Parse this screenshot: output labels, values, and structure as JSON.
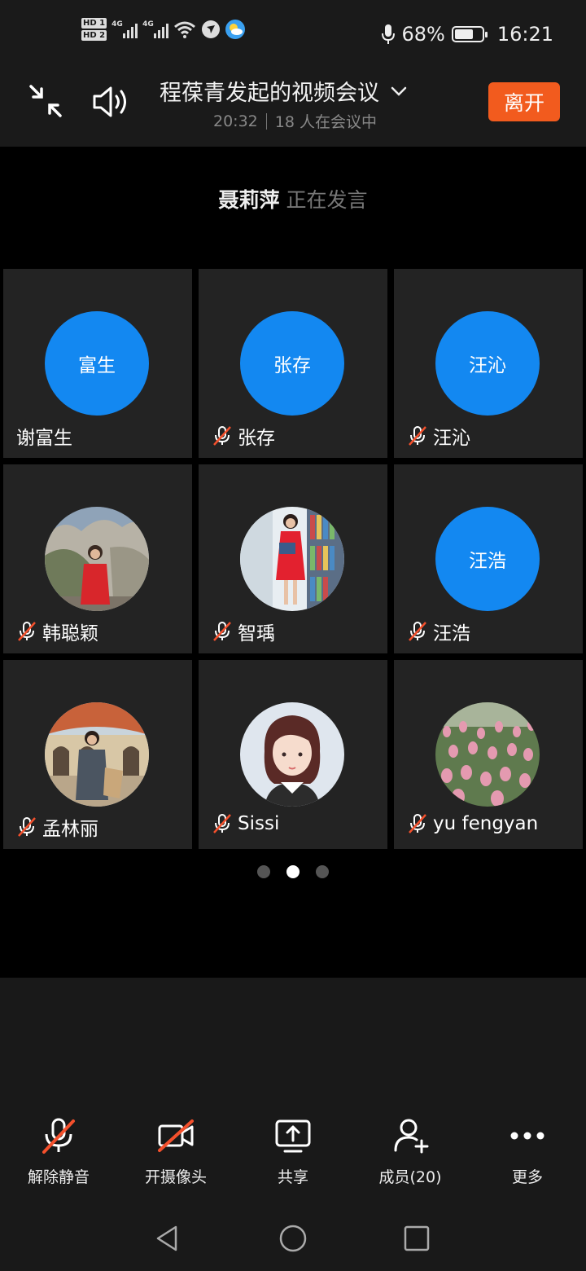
{
  "status_bar": {
    "hd1": "HD 1",
    "hd2": "HD 2",
    "net1": "4G",
    "net2": "4G",
    "battery_percent": "68%",
    "battery_level": 0.68,
    "time": "16:21"
  },
  "header": {
    "title": "程葆青发起的视频会议",
    "duration": "20:32",
    "participants_text": "18 人在会议中",
    "leave_label": "离开"
  },
  "speaking": {
    "name": "聂莉萍",
    "status": "正在发言"
  },
  "participants": [
    {
      "name": "谢富生",
      "avatar_text": "富生",
      "avatar": "blue",
      "muted": false
    },
    {
      "name": "张存",
      "avatar_text": "张存",
      "avatar": "blue",
      "muted": true
    },
    {
      "name": "汪沁",
      "avatar_text": "汪沁",
      "avatar": "blue",
      "muted": true
    },
    {
      "name": "韩聪颖",
      "avatar_text": "",
      "avatar": "photo-woman-red-coat-rocks",
      "muted": true
    },
    {
      "name": "智瑀",
      "avatar_text": "",
      "avatar": "photo-woman-red-dress-library",
      "muted": true
    },
    {
      "name": "汪浩",
      "avatar_text": "汪浩",
      "avatar": "blue",
      "muted": true
    },
    {
      "name": "孟林丽",
      "avatar_text": "",
      "avatar": "photo-woman-arches-building",
      "muted": true
    },
    {
      "name": "Sissi",
      "avatar_text": "",
      "avatar": "illustration-cartoon-girl",
      "muted": true
    },
    {
      "name": "yu fengyan",
      "avatar_text": "",
      "avatar": "photo-tulip-field",
      "muted": true
    }
  ],
  "pagination": {
    "pages": 3,
    "current": 2
  },
  "toolbar": {
    "unmute_label": "解除静音",
    "camera_label": "开摄像头",
    "share_label": "共享",
    "members_label": "成员(20)",
    "more_label": "更多"
  },
  "colors": {
    "accent_blue": "#1388f1",
    "leave_orange": "#f25b1e",
    "mute_red": "#f4502c"
  }
}
